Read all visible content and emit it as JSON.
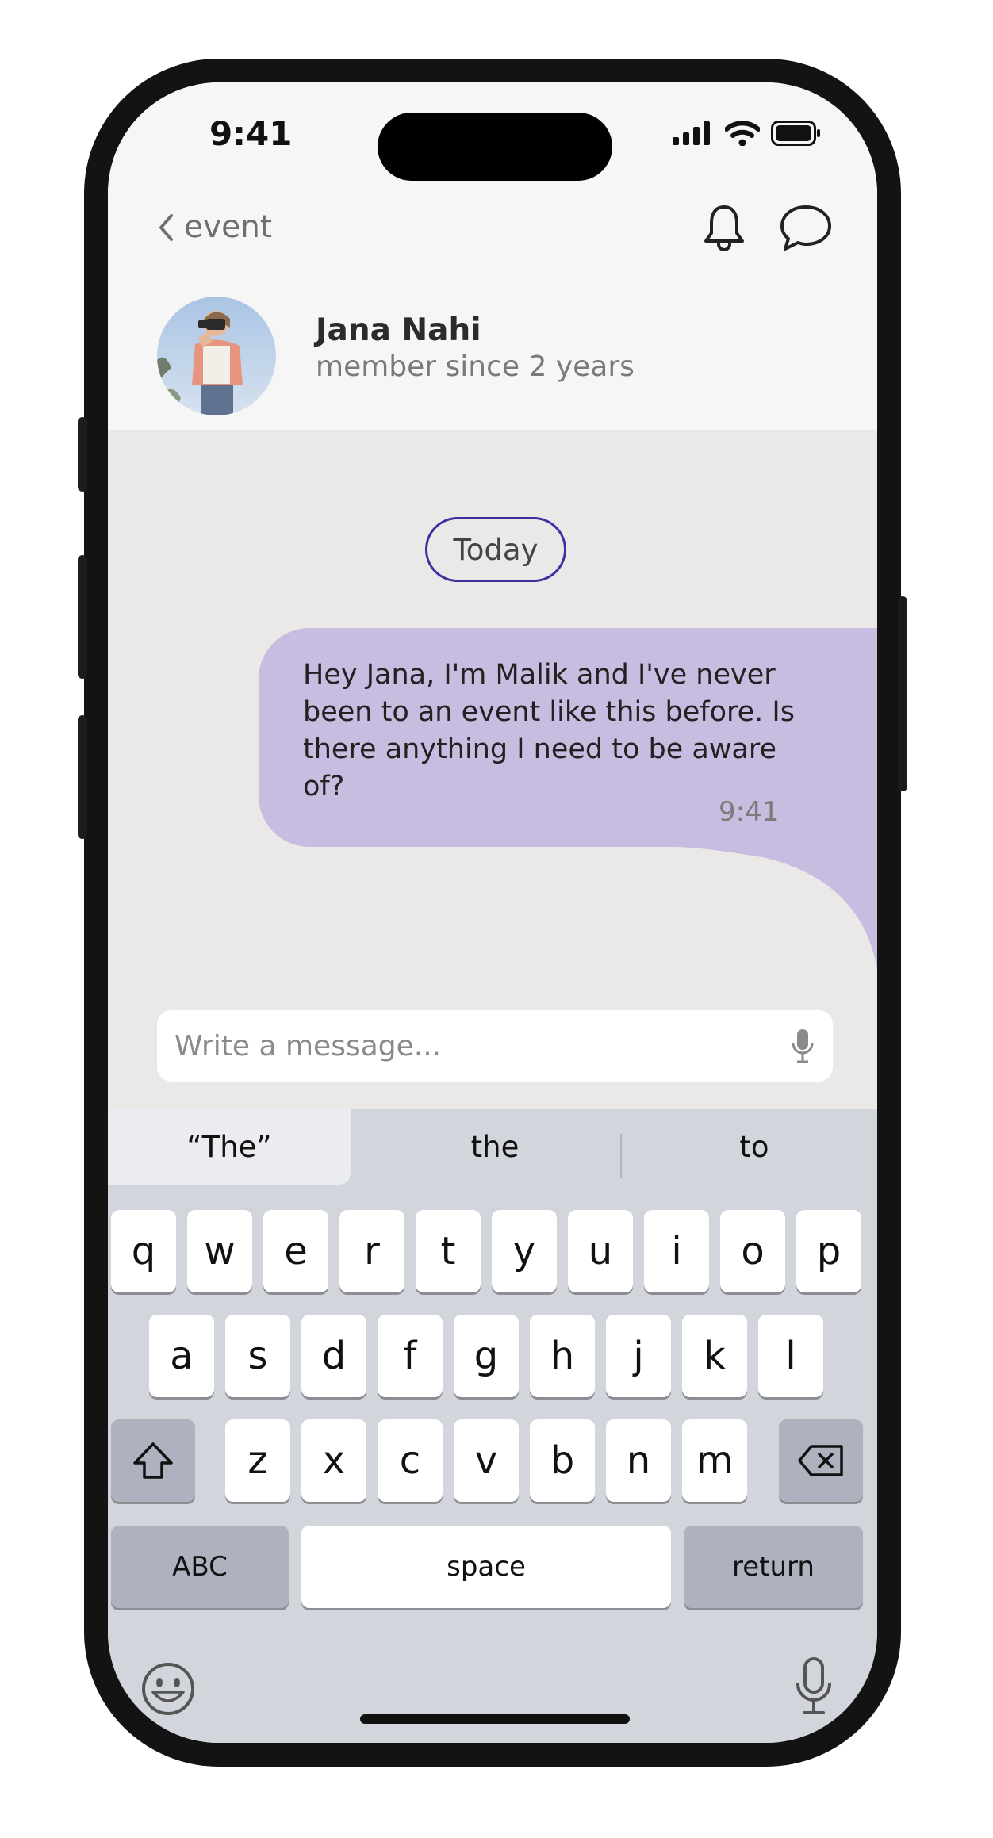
{
  "status_bar": {
    "time": "9:41"
  },
  "header": {
    "back_label": "event",
    "user_name": "Jana Nahi",
    "user_subtitle": "member since 2 years"
  },
  "chat": {
    "date_chip": "Today",
    "messages": [
      {
        "text": "Hey Jana, I'm Malik and I've never been to an event like this before. Is there anything I need to be aware of?",
        "time": "9:41"
      }
    ]
  },
  "composer": {
    "placeholder": "Write a message..."
  },
  "keyboard": {
    "suggestions": [
      "“The”",
      "the",
      "to"
    ],
    "row1": [
      "q",
      "w",
      "e",
      "r",
      "t",
      "y",
      "u",
      "i",
      "o",
      "p"
    ],
    "row2": [
      "a",
      "s",
      "d",
      "f",
      "g",
      "h",
      "j",
      "k",
      "l"
    ],
    "row3": [
      "z",
      "x",
      "c",
      "v",
      "b",
      "n",
      "m"
    ],
    "abc": "ABC",
    "space": "space",
    "return": "return"
  },
  "colors": {
    "bubble": "#c8bde0",
    "accent_border": "#3c2fa0"
  }
}
